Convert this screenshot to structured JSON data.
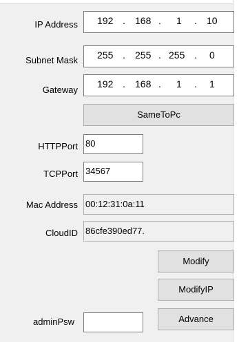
{
  "labels": {
    "ip_address": "IP Address",
    "subnet_mask": "Subnet Mask",
    "gateway": "Gateway",
    "http_port": "HTTPPort",
    "tcp_port": "TCPPort",
    "mac_address": "Mac Address",
    "cloud_id": "CloudID",
    "admin_psw": "adminPsw"
  },
  "ip_address": {
    "octets": [
      "192",
      "168",
      "1",
      "10"
    ],
    "separator": "."
  },
  "subnet_mask": {
    "octets": [
      "255",
      "255",
      "255",
      "0"
    ],
    "separator": "."
  },
  "gateway": {
    "octets": [
      "192",
      "168",
      "1",
      "1"
    ],
    "separator": "."
  },
  "fields": {
    "http_port": "80",
    "tcp_port": "34567",
    "mac_address": "00:12:31:0a:11",
    "cloud_id": "86cfe390ed77.",
    "admin_psw": ""
  },
  "buttons": {
    "same_to_pc": "SameToPc",
    "modify": "Modify",
    "modify_ip": "ModifyIP",
    "advance": "Advance"
  }
}
